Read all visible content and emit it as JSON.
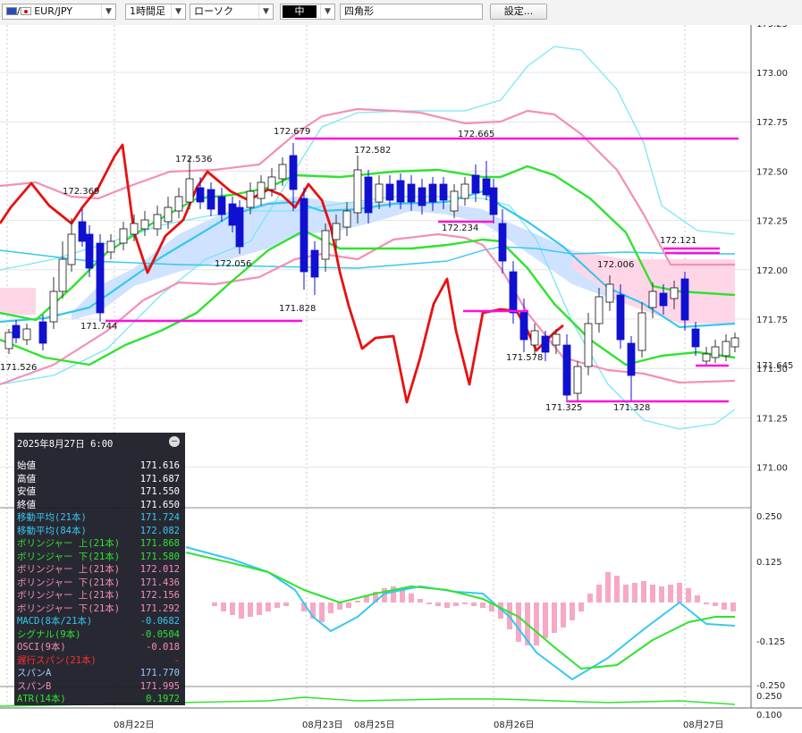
{
  "toolbar": {
    "symbol": "EUR/JPY",
    "timeframe": "1時間足",
    "chart_type": "ローソク",
    "line_width": "中",
    "drawing_tool": "四角形",
    "settings_label": "設定..."
  },
  "axis": {
    "price_ticks": [
      "173.25",
      "173.00",
      "172.75",
      "172.50",
      "172.25",
      "172.00",
      "171.75",
      "171.50",
      "171.25",
      "171.00"
    ],
    "current_price_label": "171.645",
    "macd_ticks": [
      "0.250",
      "0.125",
      "-0.125",
      "-0.250"
    ],
    "atr_ticks": [
      "0.250",
      "0.100"
    ],
    "date_labels": [
      "08月22日",
      "08月23日",
      "08月25日",
      "08月26日",
      "08月27日"
    ]
  },
  "annotations": [
    "171.526",
    "172.369",
    "171.744",
    "172.536",
    "172.056",
    "172.679",
    "171.828",
    "172.582",
    "172.665",
    "172.234",
    "171.578",
    "171.325",
    "172.006",
    "171.328",
    "172.121"
  ],
  "info": {
    "datetime": "2025年8月27日  6:00",
    "rows": [
      {
        "label": "始値",
        "value": "171.616",
        "color": "#ffffff"
      },
      {
        "label": "高値",
        "value": "171.687",
        "color": "#ffffff"
      },
      {
        "label": "安値",
        "value": "171.550",
        "color": "#ffffff"
      },
      {
        "label": "終値",
        "value": "171.650",
        "color": "#ffffff"
      },
      {
        "label": "移動平均(21本)",
        "value": "171.724",
        "color": "#35c8f0"
      },
      {
        "label": "移動平均(84本)",
        "value": "172.082",
        "color": "#35c8f0"
      },
      {
        "label": "ボリンジャー 上(21本)",
        "value": "171.868",
        "color": "#2fe32f"
      },
      {
        "label": "ボリンジャー 下(21本)",
        "value": "171.580",
        "color": "#2fe32f"
      },
      {
        "label": "ボリンジャー 上(21本)",
        "value": "172.012",
        "color": "#f48fb7"
      },
      {
        "label": "ボリンジャー 下(21本)",
        "value": "171.436",
        "color": "#f48fb7"
      },
      {
        "label": "ボリンジャー 上(21本)",
        "value": "172.156",
        "color": "#f48fb7"
      },
      {
        "label": "ボリンジャー 下(21本)",
        "value": "171.292",
        "color": "#f48fb7"
      },
      {
        "label": "MACD(8本/21本)",
        "value": "-0.0682",
        "color": "#35c8f0"
      },
      {
        "label": "シグナル(9本)",
        "value": "-0.0504",
        "color": "#2fe32f"
      },
      {
        "label": "OSCI(9本)",
        "value": "-0.018",
        "color": "#f48fb7"
      },
      {
        "label": "遅行スパン(21本)",
        "value": "-",
        "color": "#ff3030"
      },
      {
        "label": "スパンA",
        "value": "171.770",
        "color": "#9ec8ff"
      },
      {
        "label": "スパンB",
        "value": "171.995",
        "color": "#f48fb7"
      },
      {
        "label": "ATR(14本)",
        "value": "0.1972",
        "color": "#2fe32f"
      }
    ]
  },
  "colors": {
    "up_candle": "#ffffff",
    "down_candle": "#1010d0",
    "ma21": "#35c8f0",
    "bb1": "#2fe32f",
    "bb2": "#f48fb7",
    "bb3": "#78e8f4",
    "lagging": "#e81010",
    "support_lines": "#ff10d8",
    "kumo_bull": "#cfe2ff",
    "kumo_bear": "#ffd6e8"
  },
  "chart_data": {
    "type": "candlestick",
    "symbol": "EUR/JPY",
    "timeframe": "1時間足",
    "price_range": [
      170.75,
      173.25
    ],
    "marked_levels": [
      172.665,
      171.744,
      172.234,
      171.578,
      171.325,
      171.5,
      172.1
    ],
    "last": {
      "open": 171.616,
      "high": 171.687,
      "low": 171.55,
      "close": 171.65
    }
  }
}
